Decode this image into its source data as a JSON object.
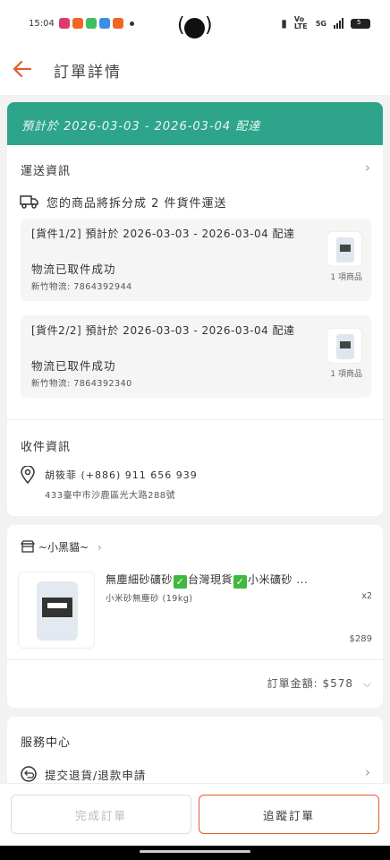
{
  "status_bar": {
    "time": "15:04",
    "app_colors": [
      "#e03a6a",
      "#f26522",
      "#3fbf5f",
      "#3a8ee6",
      "#f26522"
    ],
    "network_label": "Vo LTE",
    "network_5g": "5G",
    "battery": "5"
  },
  "header": {
    "title": "訂單詳情",
    "accent": "#e25c2c"
  },
  "banner": {
    "text": "預計於 2026-03-03 - 2026-03-04 配達",
    "color": "#2ea58b"
  },
  "shipping": {
    "section_title": "運送資訊",
    "split_notice": "您的商品將拆分成 2 件貨件運送",
    "packages": [
      {
        "title": "[貨件1/2] 預計於 2026-03-03 - 2026-03-04 配達",
        "status": "物流已取件成功",
        "tracking": "新竹物流: 7864392944",
        "item_count": "1 項商品"
      },
      {
        "title": "[貨件2/2] 預計於 2026-03-03 - 2026-03-04 配達",
        "status": "物流已取件成功",
        "tracking": "新竹物流: 7864392340",
        "item_count": "1 項商品"
      }
    ]
  },
  "recipient": {
    "section_title": "收件資訊",
    "name_phone": "胡筱菲 (+886) 911 656 939",
    "address": "433臺中市沙鹿區光大路288號"
  },
  "shop": {
    "name": "~小黑貓~",
    "product": {
      "name_part1": "無塵細砂礦砂",
      "name_part2": "台灣現貨",
      "name_part3": "小米礦砂 ...",
      "variant": "小米砂無塵砂 (19kg)",
      "quantity": "x2",
      "price": "$289"
    },
    "total": "訂單金額: $578"
  },
  "service": {
    "section_title": "服務中心",
    "refund_label": "提交退貨/退款申請"
  },
  "buttons": {
    "complete": "完成訂單",
    "track": "追蹤訂單"
  }
}
